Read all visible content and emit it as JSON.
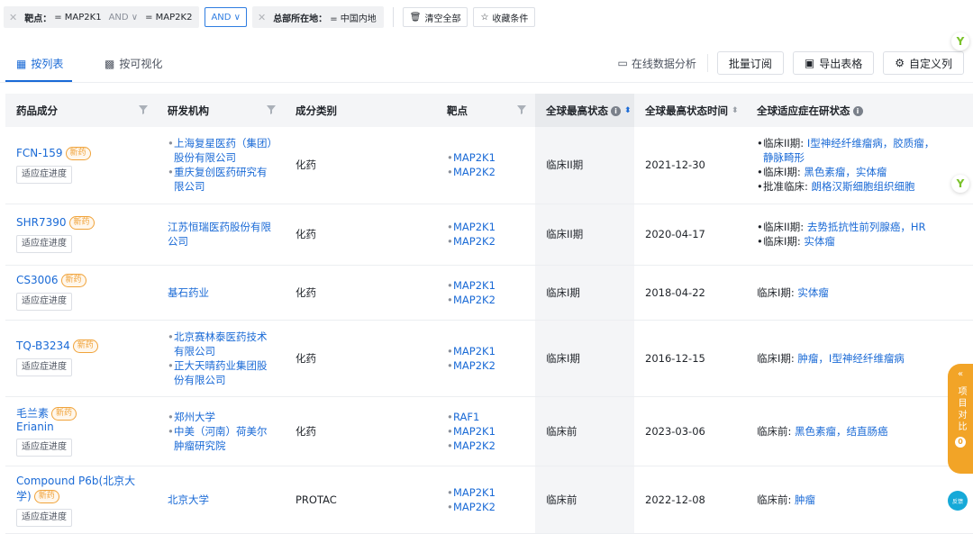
{
  "filters": {
    "chip1": {
      "label": "靶点：",
      "v1": "= MAP2K1",
      "op": "AND",
      "v2": "= MAP2K2"
    },
    "logic": "AND",
    "chip2": {
      "label": "总部所在地：",
      "v1": "= 中国内地"
    },
    "clear_all": "清空全部",
    "save_condition": "收藏条件"
  },
  "tabs": [
    {
      "label": "按列表"
    },
    {
      "label": "按可视化"
    }
  ],
  "toolbar": {
    "online_analysis": "在线数据分析",
    "batch_subscribe": "批量订阅",
    "export_table": "导出表格",
    "custom_columns": "自定义列"
  },
  "columns": [
    "药品成分",
    "研发机构",
    "成分类别",
    "靶点",
    "全球最高状态",
    "全球最高状态时间",
    "全球适应症在研状态"
  ],
  "new_badge": "新药",
  "progress_label": "适应症进度",
  "rows": [
    {
      "name": "FCN-159",
      "name2": "",
      "new": true,
      "orgs": [
        "上海复星医药（集团）股份有限公司",
        "重庆复创医药研究有限公司"
      ],
      "category": "化药",
      "targets": [
        "MAP2K1",
        "MAP2K2"
      ],
      "status": "临床II期",
      "date": "2021-12-30",
      "ind": [
        {
          "p": "临床II期: ",
          "v": "I型神经纤维瘤病，胶质瘤，"
        },
        {
          "p": "",
          "v": "静脉畸形"
        },
        {
          "p": "临床I期: ",
          "v": "黑色素瘤，实体瘤"
        },
        {
          "p": "批准临床: ",
          "v": "朗格汉斯细胞组织细胞"
        }
      ]
    },
    {
      "name": "SHR7390",
      "name2": "",
      "new": true,
      "orgs": [
        "江苏恒瑞医药股份有限公司"
      ],
      "category": "化药",
      "targets": [
        "MAP2K1",
        "MAP2K2"
      ],
      "status": "临床II期",
      "date": "2020-04-17",
      "ind": [
        {
          "p": "临床II期: ",
          "v": "去势抵抗性前列腺癌，HR"
        },
        {
          "p": "临床I期: ",
          "v": "实体瘤"
        }
      ]
    },
    {
      "name": "CS3006",
      "name2": "",
      "new": true,
      "orgs": [
        "基石药业"
      ],
      "category": "化药",
      "targets": [
        "MAP2K1",
        "MAP2K2"
      ],
      "status": "临床I期",
      "date": "2018-04-22",
      "ind": [
        {
          "p": "临床I期: ",
          "v": "实体瘤"
        }
      ]
    },
    {
      "name": "TQ-B3234",
      "name2": "",
      "new": true,
      "orgs": [
        "北京赛林泰医药技术有限公司",
        "正大天晴药业集团股份有限公司"
      ],
      "category": "化药",
      "targets": [
        "MAP2K1",
        "MAP2K2"
      ],
      "status": "临床I期",
      "date": "2016-12-15",
      "ind": [
        {
          "p": "临床I期: ",
          "v": "肿瘤，I型神经纤维瘤病"
        }
      ]
    },
    {
      "name": "毛兰素",
      "name2": "Erianin",
      "new": true,
      "orgs": [
        "郑州大学",
        "中美（河南）荷美尔肿瘤研究院"
      ],
      "category": "化药",
      "targets": [
        "RAF1",
        "MAP2K1",
        "MAP2K2"
      ],
      "status": "临床前",
      "date": "2023-03-06",
      "ind": [
        {
          "p": "临床前: ",
          "v": "黑色素瘤，结直肠癌"
        }
      ]
    },
    {
      "name": "Compound P6b(北京大学)",
      "name2": "",
      "new": true,
      "orgs": [
        "北京大学"
      ],
      "category": "PROTAC",
      "targets": [
        "MAP2K1",
        "MAP2K2"
      ],
      "status": "临床前",
      "date": "2022-12-08",
      "ind": [
        {
          "p": "临床前: ",
          "v": "肿瘤"
        }
      ]
    }
  ],
  "float": {
    "compare": "项目对比",
    "compare_count": "0",
    "feedback": "反馈"
  }
}
